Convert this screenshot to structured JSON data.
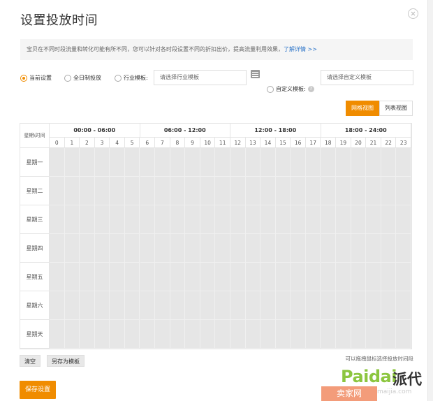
{
  "title": "设置投放时间",
  "notice": {
    "text": "宝贝在不同时段流量和转化可能有所不同，您可以针对各时段设置不同的折扣出价，提高流量利用效果，",
    "link": "了解详情 >>"
  },
  "options": {
    "current": "当前设置",
    "all_day": "全日制投放",
    "industry": "行业模板:",
    "custom": "自定义模板:"
  },
  "selects": {
    "industry_placeholder": "请选择行业模板",
    "custom_placeholder": "请选择自定义模板"
  },
  "views": {
    "grid": "网格视图",
    "list": "列表视图"
  },
  "grid": {
    "corner": "星期\\时间",
    "ranges": [
      "00:00 - 06:00",
      "06:00 - 12:00",
      "12:00 - 18:00",
      "18:00 - 24:00"
    ],
    "hours": [
      "0",
      "1",
      "2",
      "3",
      "4",
      "5",
      "6",
      "7",
      "8",
      "9",
      "10",
      "11",
      "12",
      "13",
      "14",
      "15",
      "16",
      "17",
      "18",
      "19",
      "20",
      "21",
      "22",
      "23"
    ],
    "days": [
      "星期一",
      "星期二",
      "星期三",
      "星期四",
      "星期五",
      "星期六",
      "星期天"
    ]
  },
  "buttons": {
    "clear": "清空",
    "save_template": "另存为模板",
    "save": "保存设置"
  },
  "hint": "可以拖拽鼠标选择投放时间段",
  "watermark": {
    "paidai": "Paidai",
    "paidai_cn": "派代",
    "seller": "卖家网",
    "url": "maijia.com"
  },
  "colors": {
    "accent": "#f08c00",
    "link": "#2a73c8",
    "cell": "#e6e6e6"
  }
}
